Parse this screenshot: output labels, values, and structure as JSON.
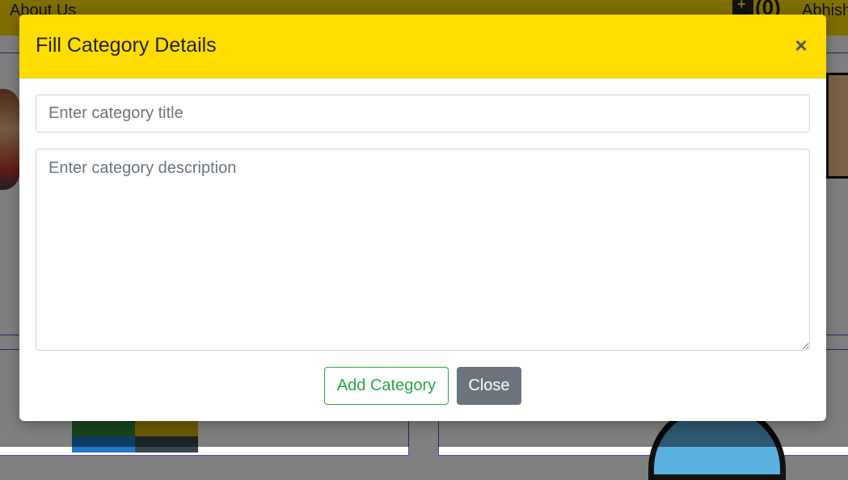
{
  "background_page": {
    "nav_link": "About Us",
    "cart_count": "(0)",
    "user_name": "Abhish"
  },
  "modal": {
    "title": "Fill Category Details",
    "close_icon": "×",
    "title_input": {
      "placeholder": "Enter category title",
      "value": ""
    },
    "description_textarea": {
      "placeholder": "Enter category description",
      "value": ""
    },
    "add_button": "Add Category",
    "close_button": "Close"
  },
  "colors": {
    "header_bg": "#ffdd00",
    "add_button": "#28a745",
    "close_button": "#6c757d"
  }
}
